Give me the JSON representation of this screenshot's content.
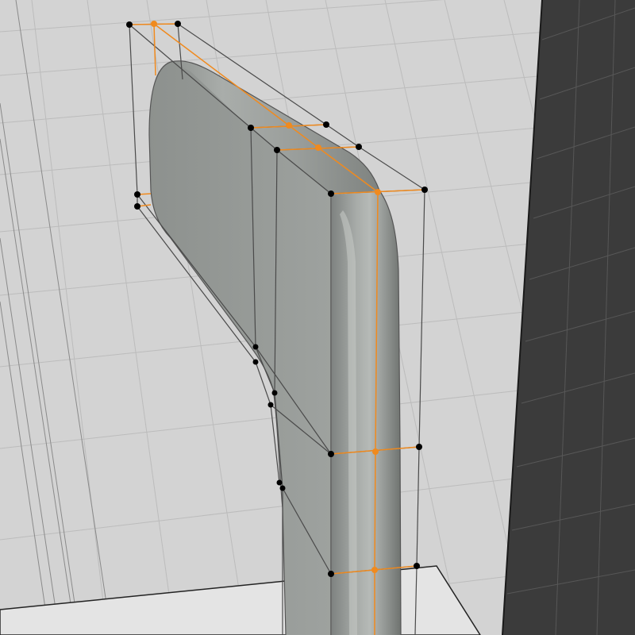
{
  "viewport": {
    "view": "3d-viewport",
    "mode": "edit-mode-subdivision-cage",
    "object": "subdivided-bent-handle",
    "colors": {
      "background_floor": "#d3d3d3",
      "floor_grid": "#b9b9b9",
      "dark_wall": "#3b3b3b",
      "dark_wall_grid": "#555555",
      "bottom_plate": "#e2e2e2",
      "mesh_surface": "#9a9e9b",
      "cage_wire": "#4a4a4a",
      "selected_edge": "#f08a1e",
      "vertex_unselected": "#000000",
      "vertex_selected": "#f08a1e"
    }
  }
}
